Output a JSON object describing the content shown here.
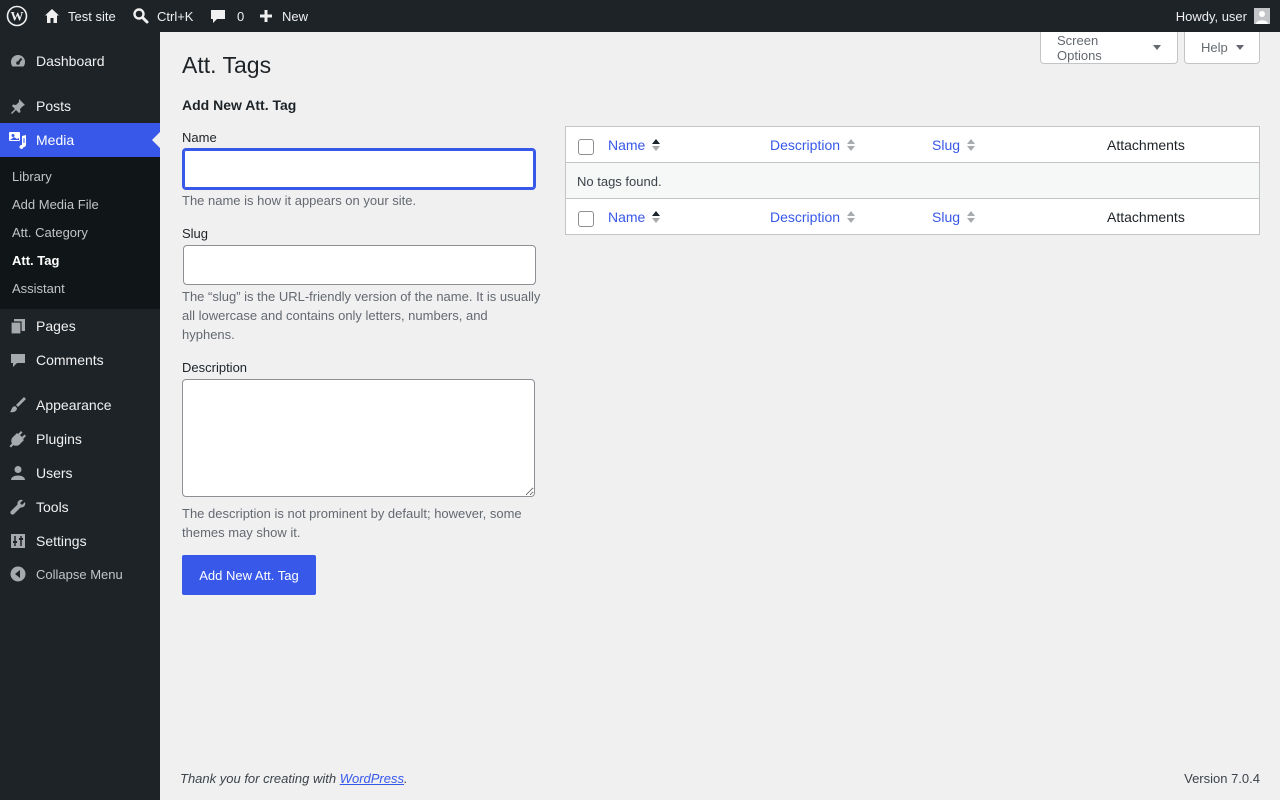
{
  "adminbar": {
    "site_name": "Test site",
    "search_shortcut": "Ctrl+K",
    "comments_count": "0",
    "new_label": "New",
    "howdy": "Howdy, user"
  },
  "sidebar": {
    "items": [
      {
        "label": "Dashboard",
        "icon": "dashboard-icon"
      },
      {
        "label": "Posts",
        "icon": "pin-icon"
      },
      {
        "label": "Media",
        "icon": "media-icon"
      },
      {
        "label": "Pages",
        "icon": "pages-icon"
      },
      {
        "label": "Comments",
        "icon": "comments-icon"
      },
      {
        "label": "Appearance",
        "icon": "brush-icon"
      },
      {
        "label": "Plugins",
        "icon": "plugin-icon"
      },
      {
        "label": "Users",
        "icon": "users-icon"
      },
      {
        "label": "Tools",
        "icon": "wrench-icon"
      },
      {
        "label": "Settings",
        "icon": "settings-icon"
      }
    ],
    "submenu": [
      "Library",
      "Add Media File",
      "Att. Category",
      "Att. Tag",
      "Assistant"
    ],
    "collapse_label": "Collapse Menu"
  },
  "screen_options_label": "Screen Options",
  "help_label": "Help",
  "page_title": "Att. Tags",
  "form": {
    "heading": "Add New Att. Tag",
    "name_label": "Name",
    "name_value": "",
    "name_help": "The name is how it appears on your site.",
    "slug_label": "Slug",
    "slug_value": "",
    "slug_help": "The “slug” is the URL-friendly version of the name. It is usually all lowercase and contains only letters, numbers, and hyphens.",
    "description_label": "Description",
    "description_value": "",
    "description_help": "The description is not prominent by default; however, some themes may show it.",
    "submit_label": "Add New Att. Tag"
  },
  "table": {
    "columns": [
      "Name",
      "Description",
      "Slug",
      "Attachments"
    ],
    "empty_text": "No tags found."
  },
  "footer": {
    "thanks_prefix": "Thank you for creating with ",
    "thanks_link": "WordPress",
    "thanks_suffix": ".",
    "version": "Version 7.0.4"
  },
  "colors": {
    "accent": "#3858e9",
    "adminbar_bg": "#1d2327",
    "sidebar_bg": "#1d2327",
    "page_bg": "#f0f0f1"
  }
}
